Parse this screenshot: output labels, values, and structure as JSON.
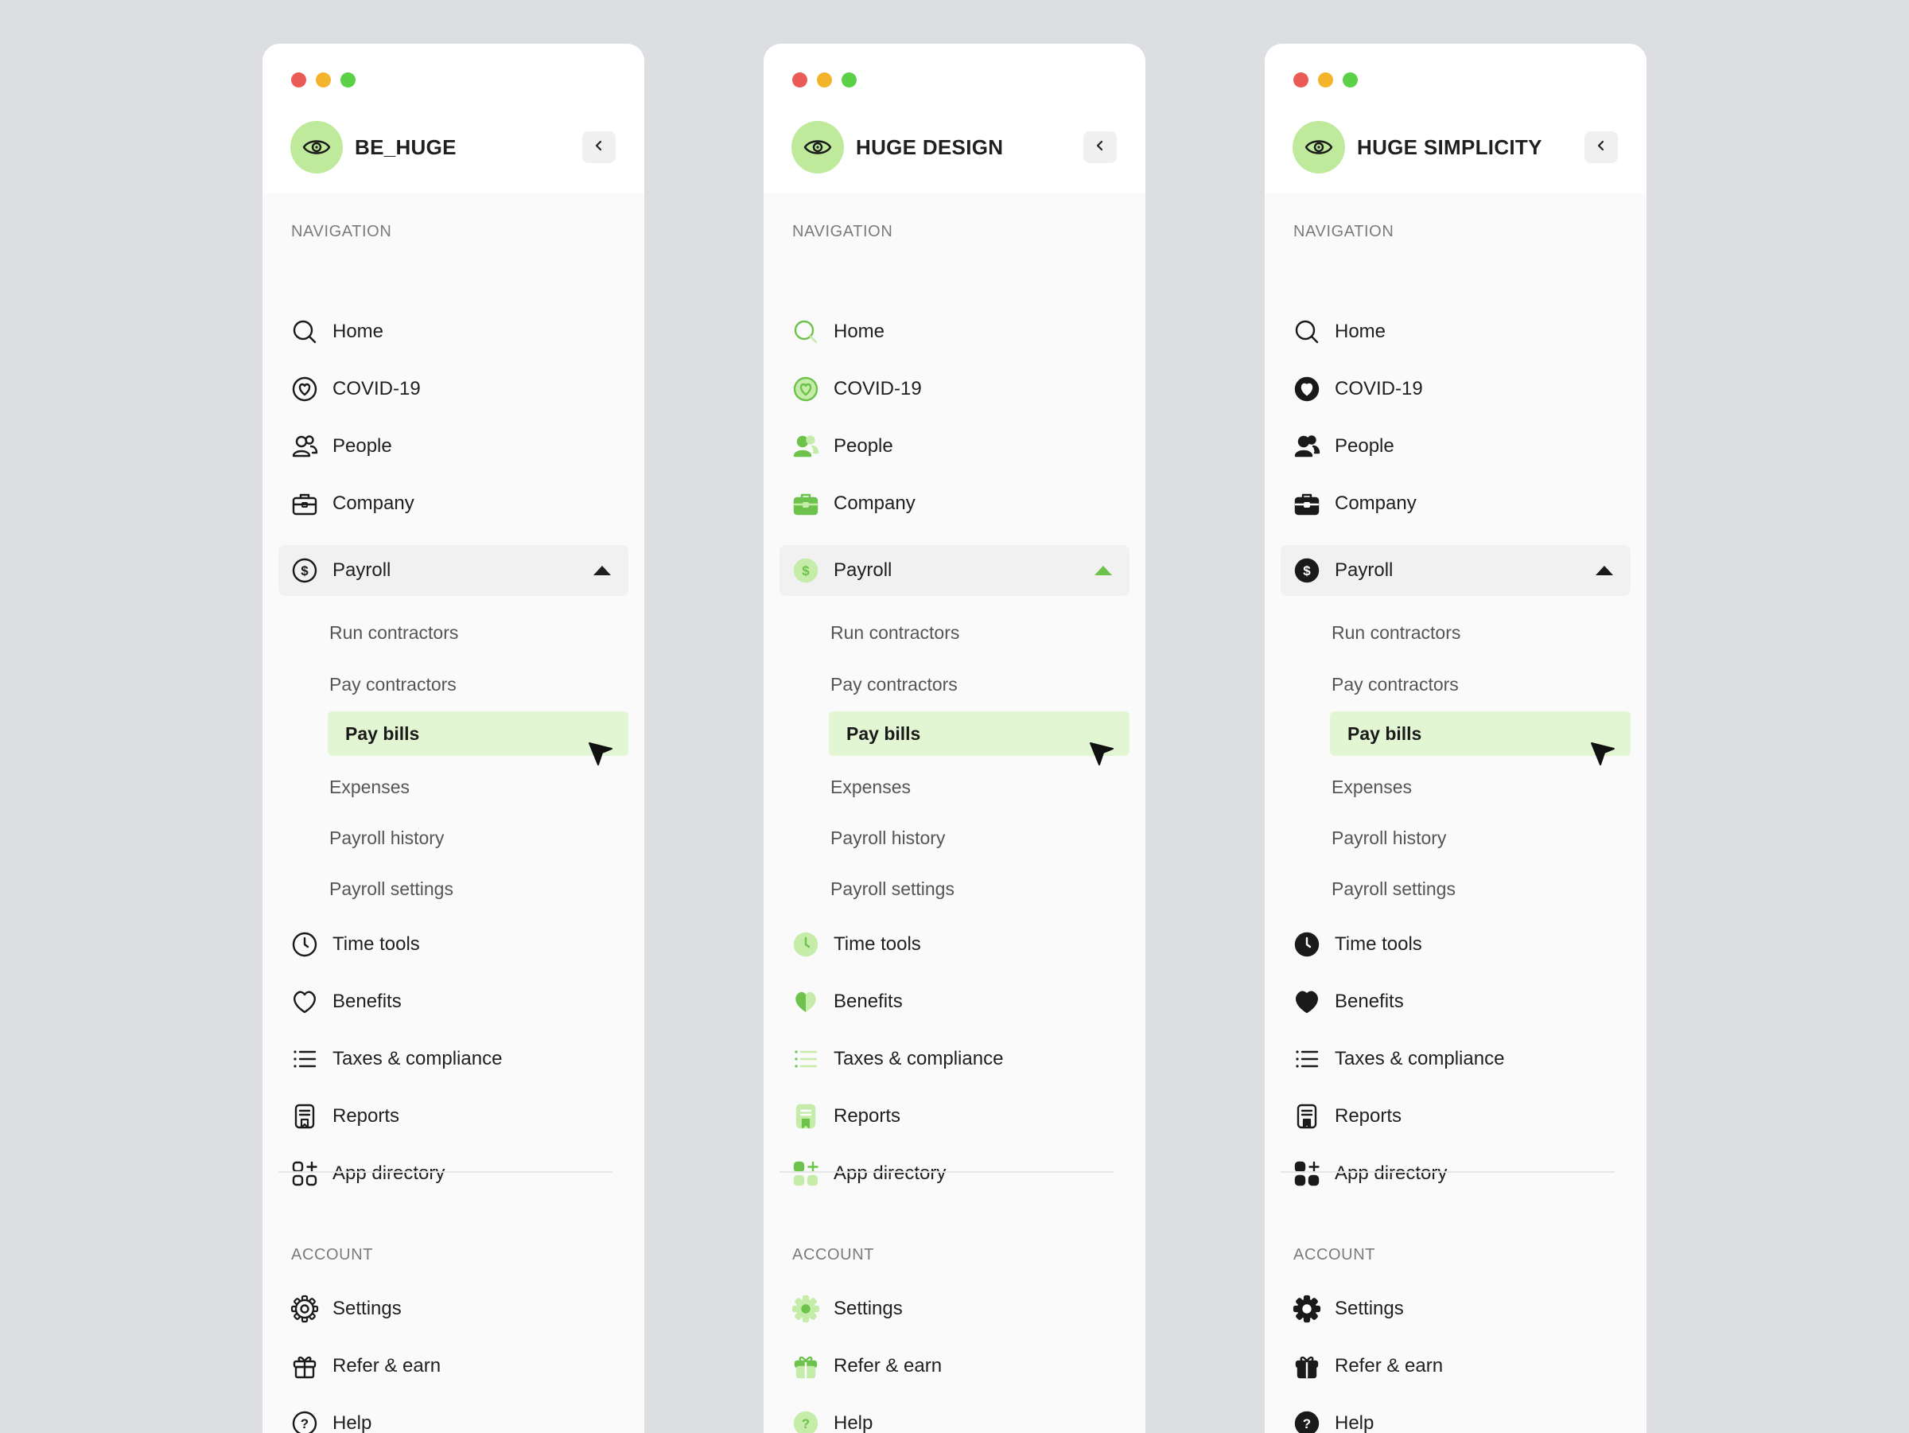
{
  "panels": [
    {
      "brand": "BE_HUGE",
      "style": "outline",
      "accent": "#1f1f1f",
      "sections": {
        "navigation": "NAVIGATION",
        "account": "ACCOUNT"
      },
      "nav": [
        "Home",
        "COVID-19",
        "People",
        "Company",
        "Payroll",
        "Time tools",
        "Benefits",
        "Taxes & compliance",
        "Reports",
        "App directory"
      ],
      "sub": [
        "Run contractors",
        "Pay contractors",
        "Pay bills",
        "Expenses",
        "Payroll history",
        "Payroll settings"
      ],
      "account": [
        "Settings",
        "Refer & earn",
        "Help"
      ]
    },
    {
      "brand": "HUGE DESIGN",
      "style": "duotone",
      "accent": "#6cc24a",
      "sections": {
        "navigation": "NAVIGATION",
        "account": "ACCOUNT"
      },
      "nav": [
        "Home",
        "COVID-19",
        "People",
        "Company",
        "Payroll",
        "Time tools",
        "Benefits",
        "Taxes & compliance",
        "Reports",
        "App directory"
      ],
      "sub": [
        "Run contractors",
        "Pay contractors",
        "Pay bills",
        "Expenses",
        "Payroll history",
        "Payroll settings"
      ],
      "account": [
        "Settings",
        "Refer & earn",
        "Help"
      ]
    },
    {
      "brand": "HUGE SIMPLICITY",
      "style": "solid",
      "accent": "#1a1a1a",
      "sections": {
        "navigation": "NAVIGATION",
        "account": "ACCOUNT"
      },
      "nav": [
        "Home",
        "COVID-19",
        "People",
        "Company",
        "Payroll",
        "Time tools",
        "Benefits",
        "Taxes & compliance",
        "Reports",
        "App directory"
      ],
      "sub": [
        "Run contractors",
        "Pay contractors",
        "Pay bills",
        "Expenses",
        "Payroll history",
        "Payroll settings"
      ],
      "account": [
        "Settings",
        "Refer & earn",
        "Help"
      ]
    }
  ],
  "icons": {
    "nav": [
      "search-icon",
      "covid-heart-icon",
      "people-icon",
      "briefcase-icon",
      "dollar-circle-icon",
      "clock-icon",
      "heart-icon",
      "list-icon",
      "reports-icon",
      "app-grid-icon"
    ],
    "account": [
      "gear-icon",
      "gift-icon",
      "help-circle-icon"
    ]
  },
  "selected_sub": "Pay bills",
  "open_nav": "Payroll"
}
